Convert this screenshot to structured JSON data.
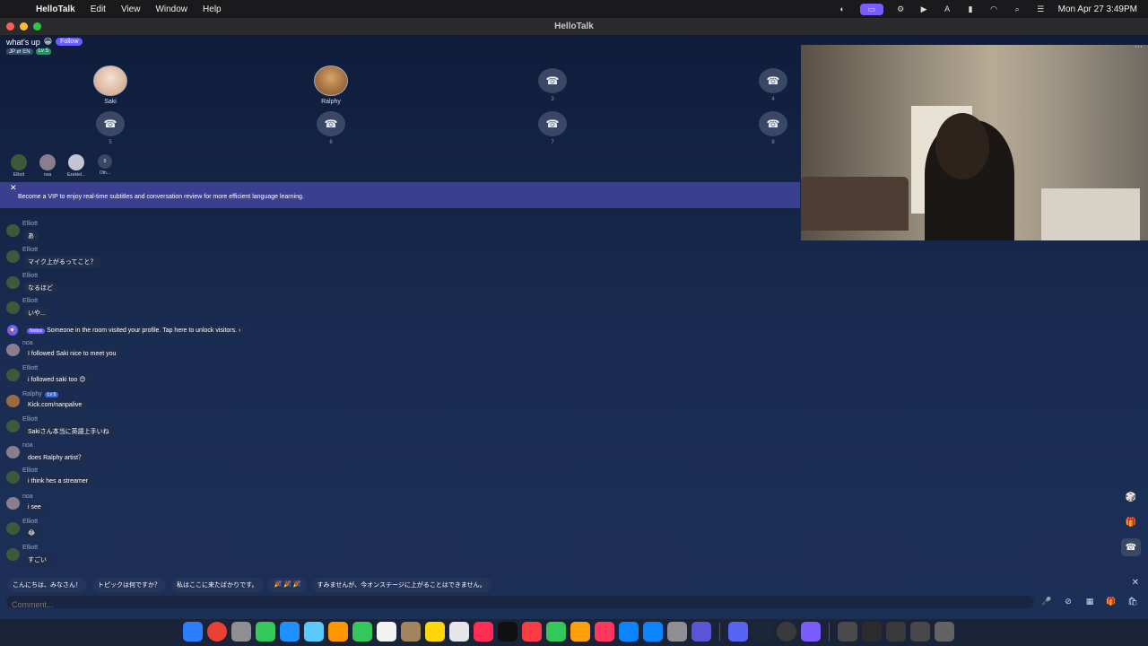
{
  "menubar": {
    "app_name": "HelloTalk",
    "menus": [
      "Edit",
      "View",
      "Window",
      "Help"
    ],
    "clock": "Mon Apr 27  3:49PM"
  },
  "window": {
    "title": "HelloTalk"
  },
  "room": {
    "title": "what's up",
    "follow_label": "Follow",
    "lang_tag": "JP ⇄ EN",
    "level_tag": "Lv 5"
  },
  "seats": [
    {
      "label": "Saki",
      "type": "user"
    },
    {
      "label": "Ralphy",
      "type": "user"
    },
    {
      "label": "3",
      "type": "empty"
    },
    {
      "label": "4",
      "type": "empty"
    },
    {
      "label": "5",
      "type": "empty"
    },
    {
      "label": "6",
      "type": "empty"
    },
    {
      "label": "7",
      "type": "empty"
    },
    {
      "label": "8",
      "type": "empty"
    }
  ],
  "audience": [
    {
      "name": "Elliott"
    },
    {
      "name": "noa"
    },
    {
      "name": "Ezekiel..."
    },
    {
      "name": "Oth...",
      "count": "8"
    }
  ],
  "vip_banner": {
    "text": "Become a VIP to enjoy real-time subtitles and conversation review for more efficient language learning."
  },
  "chat": {
    "messages": [
      {
        "user": "Elliott",
        "text": "あ"
      },
      {
        "user": "Elliott",
        "text": "マイク上がるってこと？"
      },
      {
        "user": "Elliott",
        "text": "なるほど"
      },
      {
        "user": "Elliott",
        "text": "いや..."
      },
      {
        "user": "noa",
        "text": "I followed Saki nice to meet you"
      },
      {
        "user": "Elliott",
        "text": "i followed saki too 😊"
      },
      {
        "user": "Ralphy",
        "text": "Kick.com/nanpalive",
        "tag": "Lv 5"
      },
      {
        "user": "Elliott",
        "text": "Sakiさん本当に英語上手いね"
      },
      {
        "user": "noa",
        "text": "does Ralphy artist？"
      },
      {
        "user": "Elliott",
        "text": "i think hes a streamer"
      },
      {
        "user": "noa",
        "text": "i see"
      },
      {
        "user": "Elliott",
        "text": "😂"
      },
      {
        "user": "Elliott",
        "text": "すごい"
      }
    ],
    "notice": {
      "badge": "Notice",
      "text": "Someone in the room visited your profile. Tap here to unlock visitors."
    }
  },
  "quick_replies": [
    "こんにちは、みなさん！",
    "トピックは何ですか？",
    "私はここに来たばかりです。",
    "🎉 🎉 🎉",
    "すみませんが、今オンステージに上がることはできません。"
  ],
  "compose": {
    "placeholder": "Comment..."
  },
  "colors": {
    "accent": "#6b5cff",
    "banner": "#3b3f8f",
    "background": "#0f1d3b"
  }
}
